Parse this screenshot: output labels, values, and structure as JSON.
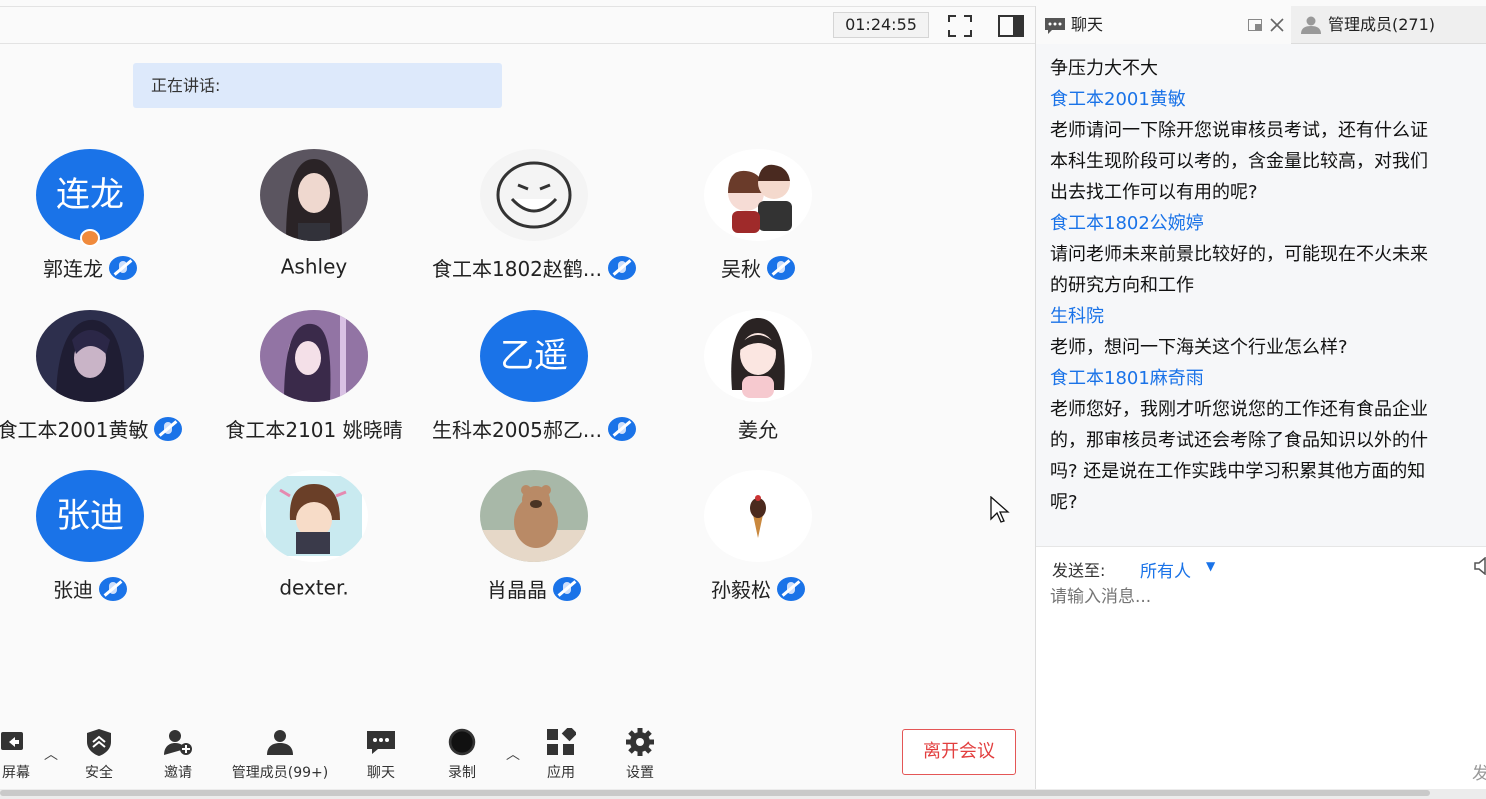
{
  "topbar": {
    "timer": "01:24:55"
  },
  "speaking": {
    "label": "正在讲话:"
  },
  "participants": [
    {
      "name": "郭连龙",
      "avatar_text": "连龙",
      "avatar_color": "#1a73e8",
      "muted": true,
      "host": true
    },
    {
      "name": "Ashley",
      "avatar_text": "",
      "muted": false
    },
    {
      "name": "食工本1802赵鹤...",
      "avatar_text": "",
      "muted": true
    },
    {
      "name": "吴秋",
      "avatar_text": "",
      "muted": true
    },
    {
      "name": "食工本2001黄敏",
      "avatar_text": "",
      "muted": true
    },
    {
      "name": "食工本2101 姚晓晴",
      "avatar_text": "",
      "muted": false
    },
    {
      "name": "生科本2005郝乙...",
      "avatar_text": "乙遥",
      "avatar_color": "#1a73e8",
      "muted": true
    },
    {
      "name": "姜允",
      "avatar_text": "",
      "muted": false
    },
    {
      "name": "张迪",
      "avatar_text": "张迪",
      "avatar_color": "#1a73e8",
      "muted": true
    },
    {
      "name": "dexter.",
      "avatar_text": "",
      "muted": false
    },
    {
      "name": "肖晶晶",
      "avatar_text": "",
      "muted": true
    },
    {
      "name": "孙毅松",
      "avatar_text": "",
      "muted": true
    }
  ],
  "toolbar": {
    "share_screen": "屏幕",
    "security": "安全",
    "invite": "邀请",
    "manage_members": "管理成员(99+)",
    "chat": "聊天",
    "record": "录制",
    "apps": "应用",
    "settings": "设置",
    "leave": "离开会议"
  },
  "panel": {
    "tab_chat": "聊天",
    "tab_members": "管理成员(271)",
    "messages": [
      {
        "type": "text",
        "text": "争压力大不大"
      },
      {
        "type": "sender",
        "text": "食工本2001黄敏"
      },
      {
        "type": "text",
        "text": "老师请问一下除开您说审核员考试，还有什么证"
      },
      {
        "type": "text",
        "text": "本科生现阶段可以考的，含金量比较高，对我们"
      },
      {
        "type": "text",
        "text": "出去找工作可以有用的呢?"
      },
      {
        "type": "sender",
        "text": "食工本1802公婉婷"
      },
      {
        "type": "text",
        "text": "请问老师未来前景比较好的，可能现在不火未来"
      },
      {
        "type": "text",
        "text": "的研究方向和工作"
      },
      {
        "type": "sender",
        "text": "生科院"
      },
      {
        "type": "text",
        "text": "老师，想问一下海关这个行业怎么样?"
      },
      {
        "type": "sender",
        "text": "食工本1801麻奇雨"
      },
      {
        "type": "text",
        "text": "老师您好，我刚才听您说您的工作还有食品企业"
      },
      {
        "type": "text",
        "text": "的，那审核员考试还会考除了食品知识以外的什"
      },
      {
        "type": "text",
        "text": "吗? 还是说在工作实践中学习积累其他方面的知"
      },
      {
        "type": "text",
        "text": "呢?"
      }
    ],
    "send_to_label": "发送至:",
    "recipient": "所有人",
    "input_placeholder": "请输入消息...",
    "send_label": "发"
  }
}
